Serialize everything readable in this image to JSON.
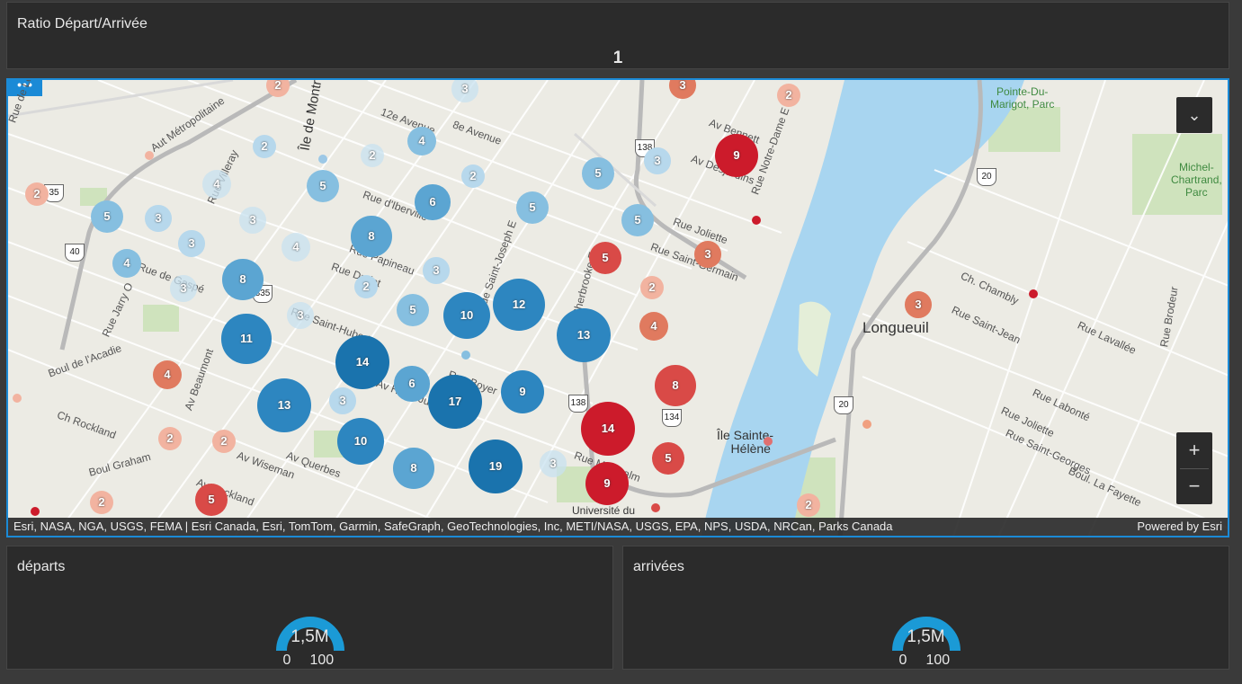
{
  "ratio": {
    "title": "Ratio Départ/Arrivée",
    "value": "1"
  },
  "map": {
    "more_label": "•••",
    "collapse_icon": "chevron-double-down-icon",
    "zoom_in": "+",
    "zoom_out": "−",
    "attribution": "Esri, NASA, NGA, USGS, FEMA | Esri Canada, Esri, TomTom, Garmin, SafeGraph, GeoTechnologies, Inc, METI/NASA, USGS, EPA, NPS, USDA, NRCan, Parks Canada",
    "powered_by": "Powered by Esri",
    "city_label": "Longueuil",
    "parks": [
      "Pointe-Du-\nMarigot, Parc",
      "Michel-\nChartrand,\nParc"
    ],
    "island_label": "Île Sainte-\nHélène",
    "univ_label": "Université du",
    "street_labels": [
      "Rue de Louvain",
      "Aut Métropolitaine",
      "12e Avenue",
      "8e Avenue",
      "Rue Villeray",
      "Av Bennett",
      "Av Desjardins",
      "Rue Joliette",
      "Rue Saint-Germain",
      "Rue Notre-Dame E",
      "Rue Jarry O",
      "Boul de l'Acadie",
      "Ch Rockland",
      "Av Beaumont",
      "Boul Graham",
      "Av Rockland",
      "Av Wiseman",
      "Av Querbes",
      "Rue Saint-Hubert",
      "Av Henri-Julien",
      "Rue Boyer",
      "Rue Sherbrooke E",
      "Rue Saint-Joseph E",
      "Rue Papineau",
      "Rue Montcalm",
      "Ch. Chambly",
      "Rue Saint-Jean",
      "Rue Lavallée",
      "Rue Brodeur",
      "Rue Labonté",
      "Rue Joliette",
      "Rue Saint-Georges",
      "Boul. La Fayette",
      "Île de Montréal",
      "Rue de Gaspé",
      "Rue Drolet",
      "Rue d'Iberville"
    ],
    "route_shields": [
      "40",
      "138",
      "20",
      "134",
      "138",
      "20",
      "335",
      "35"
    ],
    "clusters_blue": [
      3,
      2,
      4,
      2,
      5,
      5,
      6,
      2,
      5,
      4,
      3,
      5,
      3,
      3,
      8,
      4,
      4,
      3,
      3,
      2,
      8,
      3,
      5,
      10,
      12,
      13,
      11,
      14,
      6,
      17,
      9,
      13,
      3,
      10,
      8,
      19,
      3,
      5,
      3
    ],
    "clusters_red": [
      2,
      9,
      3,
      2,
      4,
      5,
      8,
      14,
      5,
      9,
      2,
      3,
      2,
      2,
      4,
      2,
      5,
      2,
      3,
      2
    ]
  },
  "departs": {
    "title": "départs",
    "value": "1,5M",
    "min": "0",
    "max": "100",
    "color": "#1b9ad6"
  },
  "arrivees": {
    "title": "arrivées",
    "value": "1,5M",
    "min": "0",
    "max": "100",
    "color": "#1b9ad6"
  }
}
